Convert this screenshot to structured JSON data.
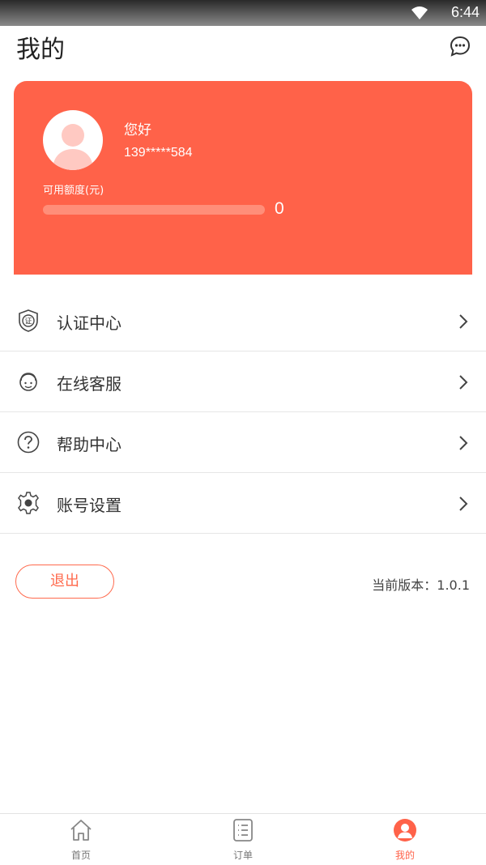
{
  "status_bar": {
    "time": "6:44"
  },
  "header": {
    "title": "我的"
  },
  "profile": {
    "greeting": "您好",
    "phone": "139*****584",
    "credit_label": "可用额度(元)",
    "credit_value": "0",
    "credit_progress": 0
  },
  "menu": {
    "items": [
      {
        "label": "认证中心",
        "icon": "certificate-badge-icon"
      },
      {
        "label": "在线客服",
        "icon": "customer-service-icon"
      },
      {
        "label": "帮助中心",
        "icon": "help-circle-icon"
      },
      {
        "label": "账号设置",
        "icon": "gear-icon"
      }
    ]
  },
  "logout": {
    "label": "退出"
  },
  "version": {
    "label": "当前版本：1.0.1"
  },
  "tab_bar": {
    "tabs": [
      {
        "label": "首页",
        "icon": "home-icon"
      },
      {
        "label": "订单",
        "icon": "order-list-icon"
      },
      {
        "label": "我的",
        "icon": "profile-icon"
      }
    ],
    "active_tab": "我的"
  },
  "colors": {
    "accent": "#ff6249",
    "card_bg": "#ff6249",
    "text": "#333333"
  }
}
